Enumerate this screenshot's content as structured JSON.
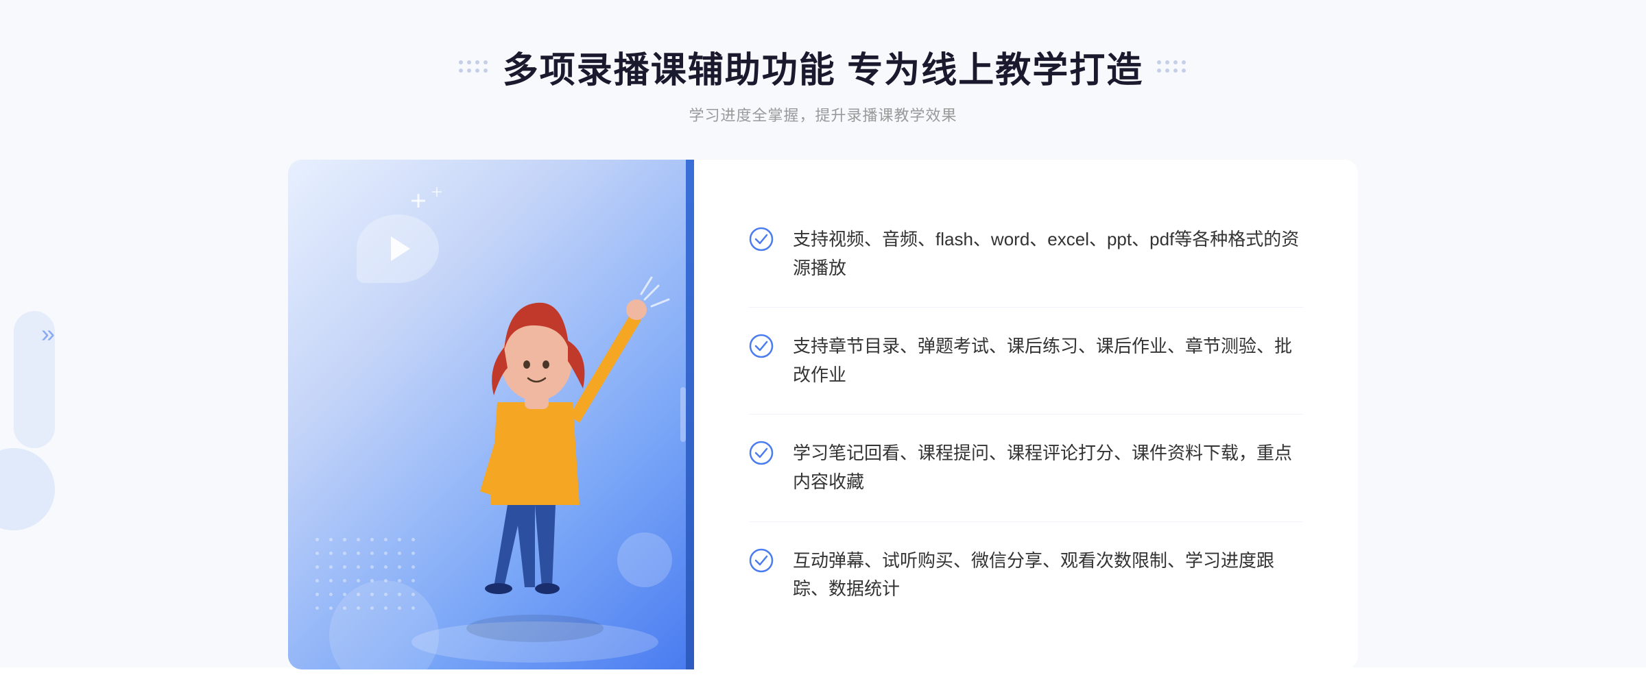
{
  "header": {
    "title": "多项录播课辅助功能 专为线上教学打造",
    "subtitle": "学习进度全掌握，提升录播课教学效果"
  },
  "features": [
    {
      "id": 1,
      "text": "支持视频、音频、flash、word、excel、ppt、pdf等各种格式的资源播放"
    },
    {
      "id": 2,
      "text": "支持章节目录、弹题考试、课后练习、课后作业、章节测验、批改作业"
    },
    {
      "id": 3,
      "text": "学习笔记回看、课程提问、课程评论打分、课件资料下载，重点内容收藏"
    },
    {
      "id": 4,
      "text": "互动弹幕、试听购买、微信分享、观看次数限制、学习进度跟踪、数据统计"
    }
  ],
  "colors": {
    "accent_blue": "#3a6fd8",
    "light_blue": "#7ba7f7",
    "check_color": "#4a7cf0",
    "title_color": "#1a1a2e",
    "subtitle_color": "#999999",
    "text_color": "#333333"
  },
  "icons": {
    "play": "▶",
    "check": "✓",
    "chevron": "»"
  }
}
